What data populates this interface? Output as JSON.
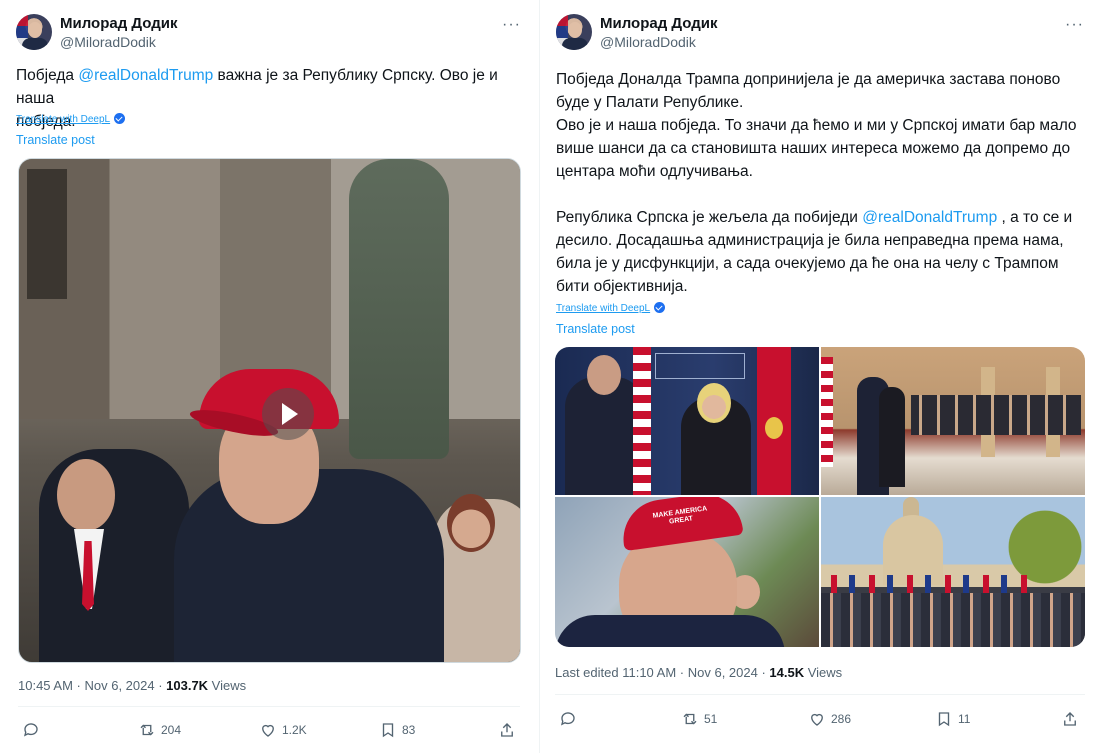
{
  "left": {
    "author": {
      "name": "Милорад Додик",
      "handle": "@MiloradDodik"
    },
    "more_icon": "more-dots-icon",
    "text": {
      "line1_before": "Побједа ",
      "mention": "@realDonaldTrump",
      "line1_after": " важна је за Републику Српску. Ово је и наша",
      "line2": "побједа."
    },
    "deepl_label": "Translate with DeepL",
    "translate_label": "Translate post",
    "media_type": "video",
    "meta": {
      "time_date": "10:45 AM · Nov 6, 2024 · ",
      "views_count": "103.7K",
      "views_label": " Views"
    },
    "actions": {
      "reply": "",
      "repost": "204",
      "like": "1.2K",
      "bookmark": "83"
    }
  },
  "right": {
    "author": {
      "name": "Милорад Додик",
      "handle": "@MiloradDodik"
    },
    "more_icon": "more-dots-icon",
    "text": {
      "p1l1": "Побједа Доналда Трампа допринијела је да америчка застава поново",
      "p1l2": "буде у Палати Републике.",
      "p1l3": "Ово је и наша побједа. То значи да ћемо и ми у Српској имати бар мало",
      "p1l4": "више шанси да са становишта наших интереса можемо да допремо до",
      "p1l5": "центара моћи одлучивања.",
      "p2l1_before": "Република Српска је жељела да побиједи ",
      "mention": "@realDonaldTrump",
      "p2l1_after": " , а то се и",
      "p2l2": "десило. Досадашња администрација је била неправедна према нама,",
      "p2l3": "била је у дисфункцији, а сада очекујемо да ће она на челу с Трампом",
      "p2l4": "бити објективнија."
    },
    "deepl_label": "Translate with DeepL",
    "translate_label": "Translate post",
    "media_type": "photo-grid",
    "meta": {
      "time_date": "Last edited 11:10 AM · Nov 6, 2024 · ",
      "views_count": "14.5K",
      "views_label": " Views"
    },
    "actions": {
      "reply": "",
      "repost": "51",
      "like": "286",
      "bookmark": "11"
    }
  },
  "colors": {
    "link": "#1d9bf0",
    "muted": "#536471",
    "text": "#0f1419",
    "divider": "#eff3f4"
  }
}
